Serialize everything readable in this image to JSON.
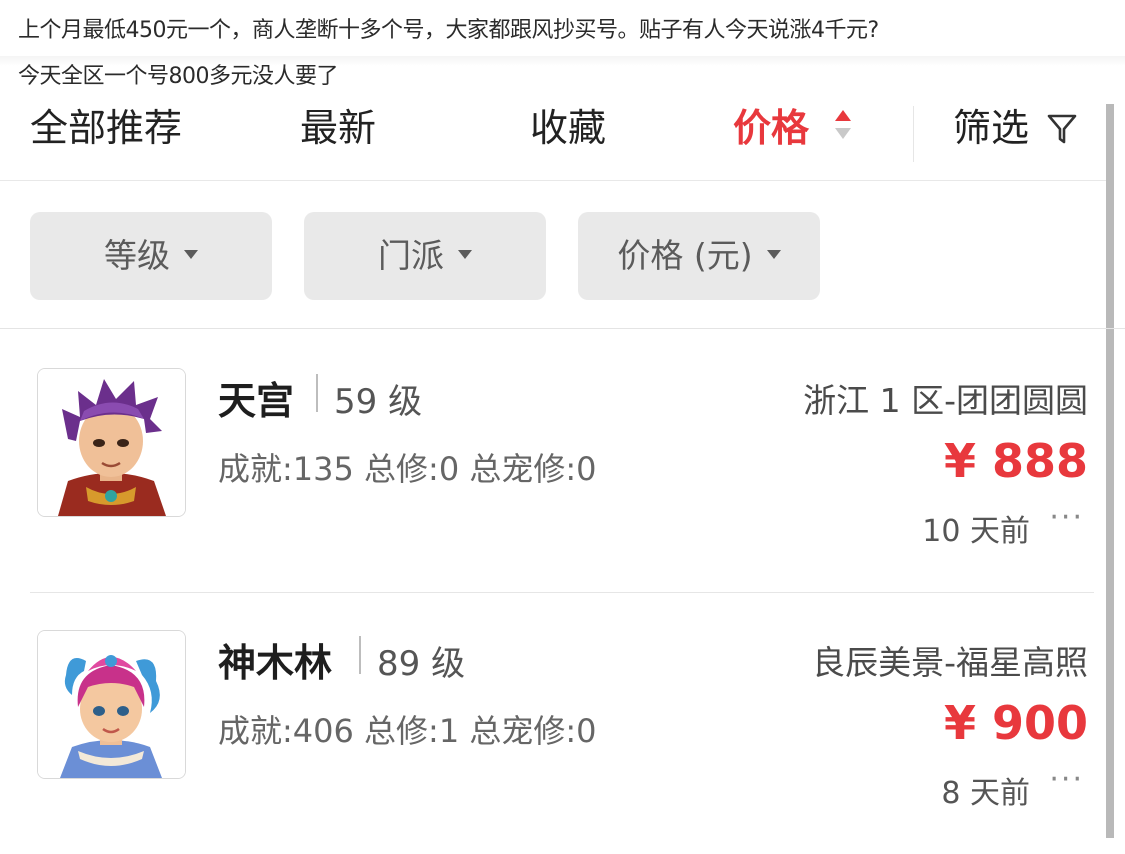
{
  "caption": {
    "line1": "上个月最低450元一个，商人垄断十多个号，大家都跟风抄买号。贴子有人今天说涨4千元?",
    "line2": "今天全区一个号800多元没人要了"
  },
  "sort_tabs": [
    {
      "label": "全部推荐",
      "active": false
    },
    {
      "label": "最新",
      "active": false
    },
    {
      "label": "收藏",
      "active": false
    },
    {
      "label": "价格",
      "active": true
    },
    {
      "label": "筛选",
      "active": false
    }
  ],
  "filters": [
    {
      "label": "等级"
    },
    {
      "label": "门派"
    },
    {
      "label": "价格 (元)"
    }
  ],
  "listings": [
    {
      "name": "天宫",
      "level": "59 级",
      "stats": "成就:135 总修:0 总宠修:0",
      "server": "浙江 1 区-团团圆圆",
      "price": "¥ 888",
      "time": "10 天前",
      "more": "···",
      "avatar_icon": "character-avatar-purple-hair"
    },
    {
      "name": "神木林",
      "level": "89 级",
      "stats": "成就:406 总修:1 总宠修:0",
      "server": "良辰美景-福星高照",
      "price": "¥ 900",
      "time": "8 天前",
      "more": "···",
      "avatar_icon": "character-avatar-pink-hair"
    }
  ],
  "colors": {
    "accent": "#e8383d",
    "chip_bg": "#e9e9e9",
    "divider": "#e6e6e6"
  },
  "icons": {
    "sort": "sort-arrows-icon",
    "filter": "filter-funnel-icon"
  }
}
